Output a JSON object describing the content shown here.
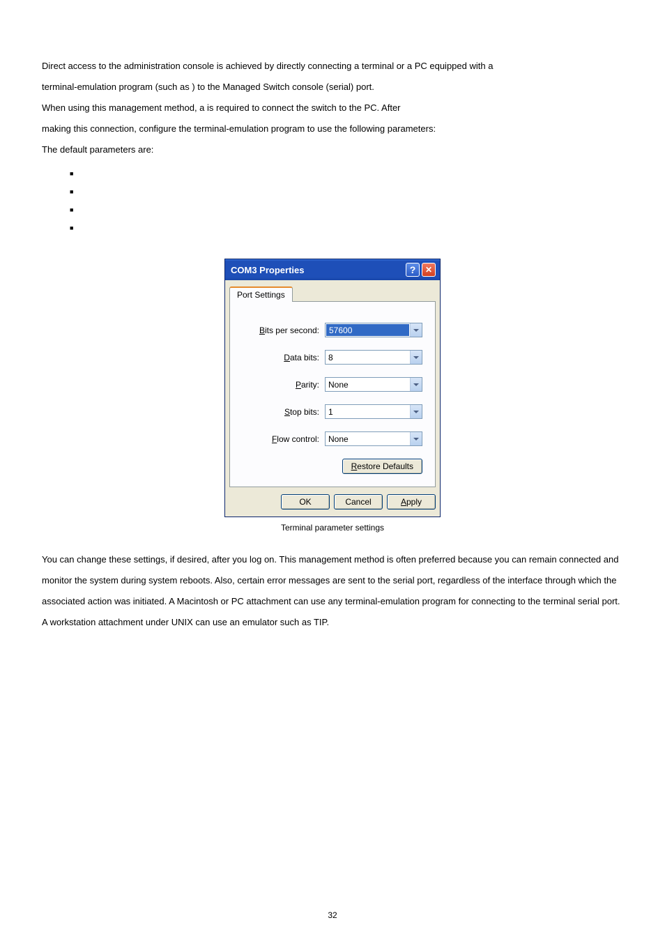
{
  "intro": {
    "line1_a": "Direct access to the administration console is achieved by directly connecting a terminal or a PC equipped with a",
    "line2_a": "terminal-emulation program (such as ",
    "line2_b": ") to the Managed Switch console (serial) port.",
    "line3_a": "When using this management method, a ",
    "line3_b": "is required to connect the switch to the PC. After",
    "line4": "making this connection, configure the terminal-emulation program to use the following parameters:",
    "line5": "The default parameters are:"
  },
  "dialog": {
    "title": "COM3 Properties",
    "tab": "Port Settings",
    "fields": {
      "bps_label": "its per second:",
      "bps_value": "57600",
      "databits_label": "ata bits:",
      "databits_value": "8",
      "parity_label": "arity:",
      "parity_value": "None",
      "stopbits_label": "top bits:",
      "stopbits_value": "1",
      "flow_label": "low control:",
      "flow_value": "None"
    },
    "buttons": {
      "restore": "estore Defaults",
      "ok": "OK",
      "cancel": "Cancel",
      "apply": "pply"
    }
  },
  "caption": "Terminal parameter settings",
  "para2": "You can change these settings, if desired, after you log on. This management method is often preferred because you can remain connected and monitor the system during system reboots. Also, certain error messages are sent to the serial port, regardless of the interface through which the associated action was initiated. A Macintosh or PC attachment can use any terminal-emulation program for connecting to the terminal serial port. A workstation attachment under UNIX can use an emulator such as TIP.",
  "page_number": "32"
}
